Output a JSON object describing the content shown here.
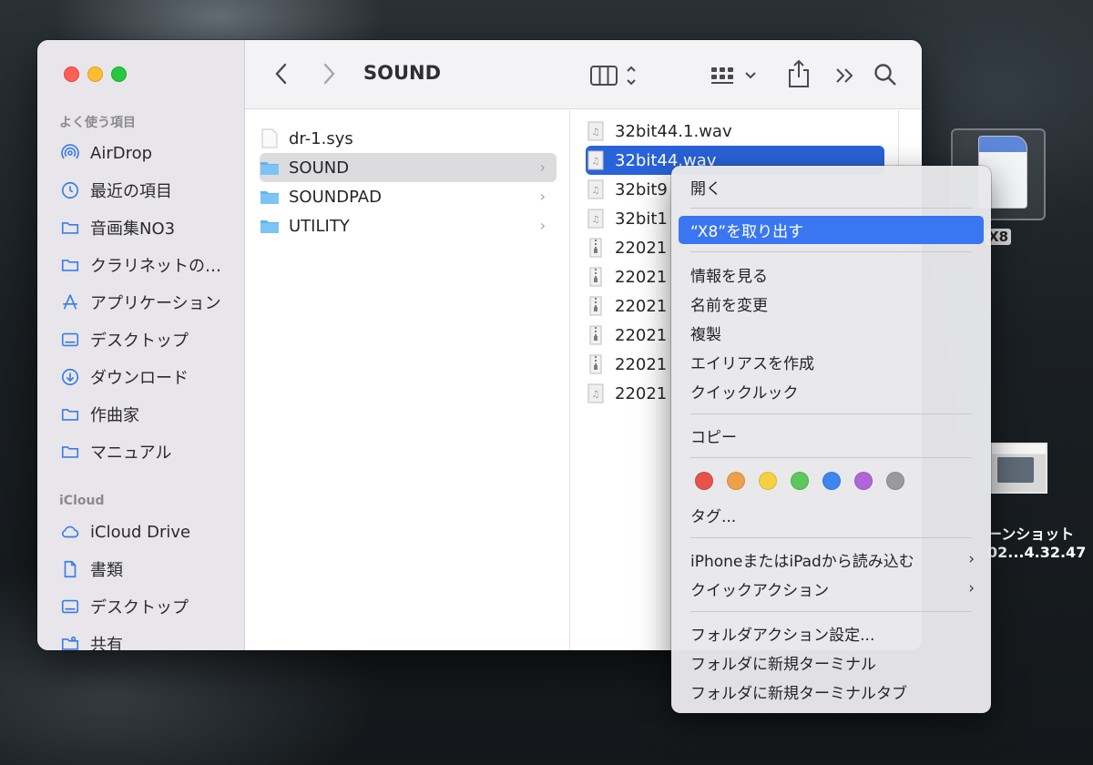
{
  "sidebar": {
    "favorites_header": "よく使う項目",
    "favorites": [
      {
        "label": "AirDrop",
        "icon": "airdrop-icon"
      },
      {
        "label": "最近の項目",
        "icon": "clock-icon"
      },
      {
        "label": "音画集NO3",
        "icon": "folder-icon"
      },
      {
        "label": "クラリネットの…",
        "icon": "folder-icon"
      },
      {
        "label": "アプリケーション",
        "icon": "applications-icon"
      },
      {
        "label": "デスクトップ",
        "icon": "desktop-icon"
      },
      {
        "label": "ダウンロード",
        "icon": "download-icon"
      },
      {
        "label": "作曲家",
        "icon": "folder-icon"
      },
      {
        "label": "マニュアル",
        "icon": "folder-icon"
      }
    ],
    "icloud_header": "iCloud",
    "icloud": [
      {
        "label": "iCloud Drive",
        "icon": "cloud-icon"
      },
      {
        "label": "書類",
        "icon": "document-icon"
      },
      {
        "label": "デスクトップ",
        "icon": "desktop-icon"
      },
      {
        "label": "共有",
        "icon": "shared-folder-icon"
      }
    ]
  },
  "toolbar": {
    "title": "SOUND",
    "back_icon": "chevron-left-icon",
    "forward_icon": "chevron-right-icon",
    "view_icon": "column-view-icon",
    "group_icon": "grid-group-icon",
    "share_icon": "share-icon",
    "more_icon": "double-chevron-icon",
    "search_icon": "search-icon"
  },
  "column1": [
    {
      "name": "dr-1.sys",
      "kind": "file",
      "selected": false
    },
    {
      "name": "SOUND",
      "kind": "folder",
      "selected": true
    },
    {
      "name": "SOUNDPAD",
      "kind": "folder",
      "selected": false
    },
    {
      "name": "UTILITY",
      "kind": "folder",
      "selected": false
    }
  ],
  "column2": [
    {
      "name": "32bit44.1.wav",
      "kind": "audio"
    },
    {
      "name": "32bit44.wav",
      "kind": "audio",
      "selected": true
    },
    {
      "name": "32bit9",
      "kind": "audio"
    },
    {
      "name": "32bit1",
      "kind": "audio"
    },
    {
      "name": "22021",
      "kind": "zip"
    },
    {
      "name": "22021",
      "kind": "zip"
    },
    {
      "name": "22021",
      "kind": "zip"
    },
    {
      "name": "22021",
      "kind": "zip"
    },
    {
      "name": "22021",
      "kind": "zip"
    },
    {
      "name": "22021",
      "kind": "audio"
    }
  ],
  "desktop": {
    "sd_label": "X8",
    "screenshot_label_1": "ーンショット",
    "screenshot_label_2": "02...4.32.47"
  },
  "context_menu": {
    "open": "開く",
    "eject": "“X8”を取り出す",
    "get_info": "情報を見る",
    "rename": "名前を変更",
    "duplicate": "複製",
    "make_alias": "エイリアスを作成",
    "quick_look": "クイックルック",
    "copy": "コピー",
    "tags": "タグ...",
    "import_iphone": "iPhoneまたはiPadから読み込む",
    "quick_actions": "クイックアクション",
    "folder_actions": "フォルダアクション設定...",
    "new_terminal": "フォルダに新規ターミナル",
    "new_terminal_tab": "フォルダに新規ターミナルタブ",
    "tag_colors": [
      "#e5534b",
      "#f0a04a",
      "#f5d142",
      "#5ac85a",
      "#3d86f0",
      "#b065d8",
      "#9a9a9e"
    ]
  }
}
